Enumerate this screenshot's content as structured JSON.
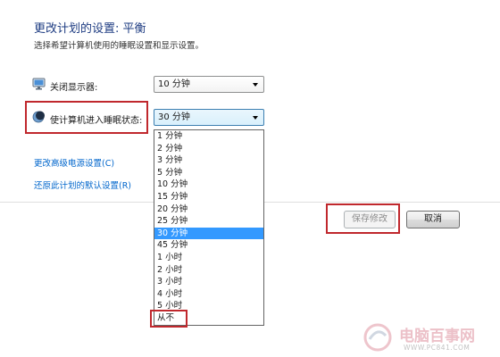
{
  "header": {
    "title": "更改计划的设置: 平衡",
    "subtitle": "选择希望计算机使用的睡眠设置和显示设置。"
  },
  "display": {
    "icon": "monitor-icon",
    "label": "关闭显示器:",
    "value": "10 分钟"
  },
  "sleep": {
    "icon": "sleep-icon",
    "label": "使计算机进入睡眠状态:",
    "value": "30 分钟",
    "highlighted_index": 8,
    "options": [
      "1 分钟",
      "2 分钟",
      "3 分钟",
      "5 分钟",
      "10 分钟",
      "15 分钟",
      "20 分钟",
      "25 分钟",
      "30 分钟",
      "45 分钟",
      "1 小时",
      "2 小时",
      "3 小时",
      "4 小时",
      "5 小时",
      "从不"
    ]
  },
  "links": {
    "advanced": "更改高级电源设置(C)",
    "restore": "还原此计划的默认设置(R)"
  },
  "buttons": {
    "save": "保存修改",
    "cancel": "取消"
  },
  "watermark": {
    "name": "电脑百事网",
    "url": "WWW.PC841.COM"
  },
  "colors": {
    "title": "#1e3c82",
    "link": "#0066cc",
    "selection": "#3399ff",
    "annotation": "#c0282d"
  }
}
